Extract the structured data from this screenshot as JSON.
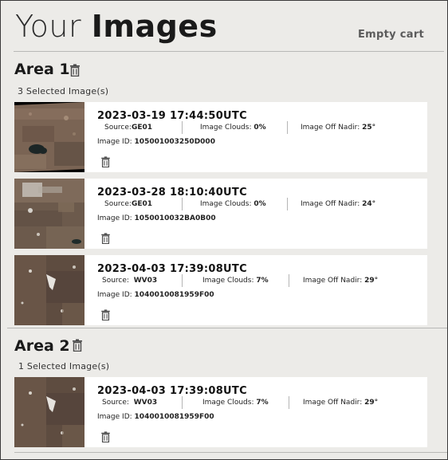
{
  "header": {
    "title_light": "Your",
    "title_bold": "Images",
    "empty_cart_label": "Empty cart"
  },
  "areas": [
    {
      "title": "Area 1",
      "count_label": "3 Selected Image(s)",
      "images": [
        {
          "date": "2023-03-19 17:44:50UTC",
          "source_label": "Source:",
          "source": "GE01",
          "clouds_label": "Image Clouds:",
          "clouds": "0%",
          "nadir_label": "Image Off Nadir:",
          "nadir": "25°",
          "id_label": "Image ID:",
          "id": "105001003250D000"
        },
        {
          "date": "2023-03-28 18:10:40UTC",
          "source_label": "Source:",
          "source": "GE01",
          "clouds_label": "Image Clouds:",
          "clouds": "0%",
          "nadir_label": "Image Off Nadir:",
          "nadir": "24°",
          "id_label": "Image ID:",
          "id": "1050010032BA0B00"
        },
        {
          "date": "2023-04-03 17:39:08UTC",
          "source_label": "Source:",
          "source": "WV03",
          "clouds_label": "Image Clouds:",
          "clouds": "7%",
          "nadir_label": "Image Off Nadir:",
          "nadir": "29°",
          "id_label": "Image ID:",
          "id": "1040010081959F00"
        }
      ]
    },
    {
      "title": "Area 2",
      "count_label": "1 Selected Image(s)",
      "images": [
        {
          "date": "2023-04-03 17:39:08UTC",
          "source_label": "Source:",
          "source": "WV03",
          "clouds_label": "Image Clouds:",
          "clouds": "7%",
          "nadir_label": "Image Off Nadir:",
          "nadir": "29°",
          "id_label": "Image ID:",
          "id": "1040010081959F00"
        }
      ]
    }
  ],
  "icons": {
    "delete": "trash-icon"
  }
}
